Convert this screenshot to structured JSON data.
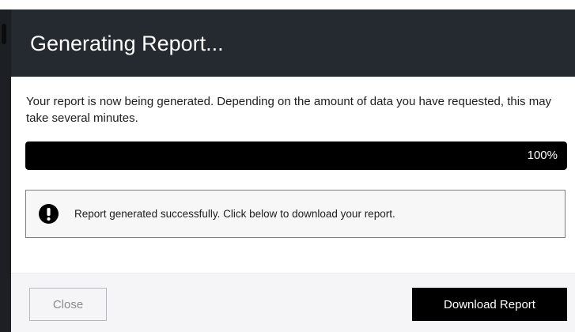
{
  "dialog": {
    "title": "Generating Report...",
    "description": "Your report is now being generated. Depending on the amount of data you have requested, this may take several minutes.",
    "progress": {
      "percent": 100,
      "label": "100%",
      "fill_color": "#000000"
    },
    "alert": {
      "icon": "exclamation-icon",
      "message": "Report generated successfully. Click below to download your report."
    },
    "buttons": {
      "close_label": "Close",
      "download_label": "Download Report"
    }
  },
  "colors": {
    "header_bg": "#252a30",
    "footer_bg": "#f5f5f7",
    "primary_button_bg": "#000000"
  }
}
